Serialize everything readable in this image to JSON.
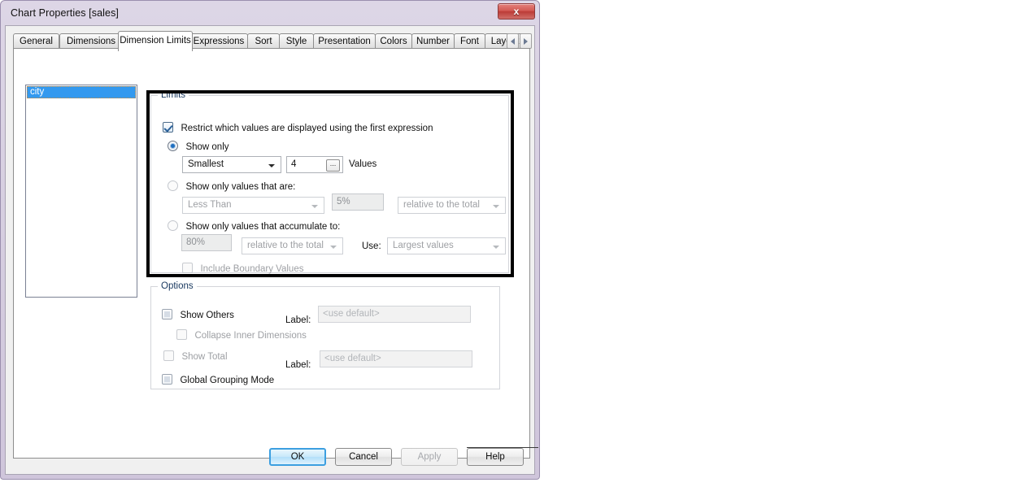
{
  "window": {
    "title": "Chart Properties [sales]",
    "close_label": "x",
    "close_icon": "close-icon"
  },
  "tabs": [
    {
      "label": "General",
      "selected": false
    },
    {
      "label": "Dimensions",
      "selected": false
    },
    {
      "label": "Dimension Limits",
      "selected": true
    },
    {
      "label": "Expressions",
      "selected": false
    },
    {
      "label": "Sort",
      "selected": false
    },
    {
      "label": "Style",
      "selected": false
    },
    {
      "label": "Presentation",
      "selected": false
    },
    {
      "label": "Colors",
      "selected": false
    },
    {
      "label": "Number",
      "selected": false
    },
    {
      "label": "Font",
      "selected": false
    },
    {
      "label": "Layout",
      "selected": false
    }
  ],
  "tab_scroll": {
    "left_icon": "chevron-left-icon",
    "right_icon": "chevron-right-icon"
  },
  "dimension_list": {
    "items": [
      {
        "label": "city",
        "selected": true
      }
    ]
  },
  "limits": {
    "title": "Limits",
    "restrict": {
      "label": "Restrict which values are displayed using the first expression",
      "checked": true
    },
    "show_only": {
      "label": "Show only",
      "selected": true,
      "mode_value": "Smallest",
      "count_value": "4",
      "ellipsis_label": "...",
      "values_label": "Values"
    },
    "values_that_are": {
      "label": "Show only values that are:",
      "selected": false,
      "operator_value": "Less Than",
      "amount_value": "5%",
      "basis_value": "relative to the total"
    },
    "accumulate_to": {
      "label": "Show only values that accumulate to:",
      "selected": false,
      "amount_value": "80%",
      "basis_value": "relative to the total",
      "use_label": "Use:",
      "use_value": "Largest values"
    },
    "include_boundary": {
      "label": "Include Boundary Values",
      "checked": false,
      "disabled": true
    }
  },
  "options": {
    "title": "Options",
    "show_others": {
      "label": "Show Others",
      "checked": false,
      "label_caption": "Label:",
      "label_placeholder": "<use default>"
    },
    "collapse_inner": {
      "label": "Collapse Inner Dimensions",
      "checked": false,
      "disabled": true
    },
    "show_total": {
      "label": "Show Total",
      "checked": false,
      "disabled": true,
      "label_caption": "Label:",
      "label_placeholder": "<use default>"
    },
    "global_grouping": {
      "label": "Global Grouping Mode",
      "checked": false
    }
  },
  "buttons": {
    "ok": "OK",
    "cancel": "Cancel",
    "apply": "Apply",
    "help": "Help"
  },
  "colors": {
    "selection_blue": "#3399ef",
    "default_button_blue": "#3c9fe0",
    "group_title": "#17375e",
    "highlight_black": "#000000",
    "close_red": "#bc3c37"
  }
}
